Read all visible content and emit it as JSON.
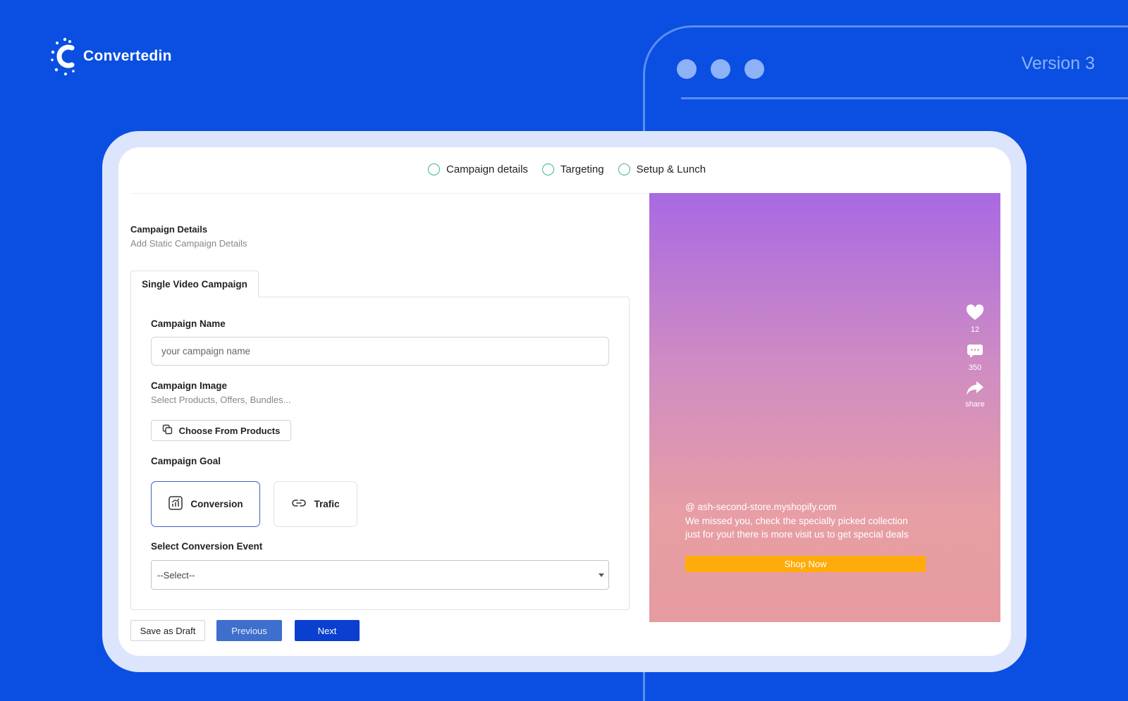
{
  "brand": {
    "name": "Convertedin",
    "logo_icon": "c-splash-logo-icon"
  },
  "background": {
    "version_label": "Version 3",
    "window_dots": 3
  },
  "colors": {
    "background": "#0a4fe2",
    "primary": "#0a3fcf",
    "step_ring": "#3eb39a",
    "shop_button": "#ffac0a"
  },
  "stepper": {
    "steps": [
      {
        "label": "Campaign details"
      },
      {
        "label": "Targeting"
      },
      {
        "label": "Setup & Lunch"
      }
    ]
  },
  "form": {
    "section_title": "Campaign Details",
    "section_subtitle": "Add Static Campaign Details",
    "tab_label": "Single Video Campaign",
    "campaign_name": {
      "label": "Campaign Name",
      "placeholder": "your campaign name",
      "value": ""
    },
    "campaign_image": {
      "label": "Campaign Image",
      "hint": "Select Products, Offers, Bundles...",
      "button_label": "Choose From Products"
    },
    "campaign_goal": {
      "label": "Campaign Goal",
      "options": [
        {
          "label": "Conversion",
          "selected": true,
          "icon": "chart-icon"
        },
        {
          "label": "Trafic",
          "selected": false,
          "icon": "link-icon"
        }
      ]
    },
    "conversion_event": {
      "label": "Select Conversion Event",
      "selected": "--Select--"
    }
  },
  "footer": {
    "save_draft_label": "Save as Draft",
    "previous_label": "Previous",
    "next_label": "Next"
  },
  "preview": {
    "likes": "12",
    "comments": "350",
    "share_label": "share",
    "store_handle": "@ ash-second-store.myshopify.com",
    "message": "We missed you, check the specially picked collection just for you! there is more visit us to get special deals",
    "cta_label": "Shop Now"
  }
}
